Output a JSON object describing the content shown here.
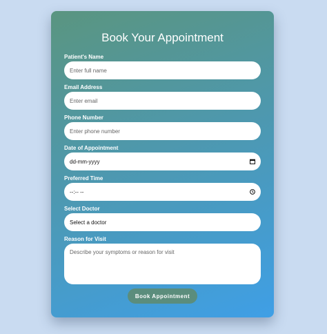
{
  "form": {
    "title": "Book Your Appointment",
    "patient_name": {
      "label": "Patient's Name",
      "placeholder": "Enter full name"
    },
    "email": {
      "label": "Email Address",
      "placeholder": "Enter email"
    },
    "phone": {
      "label": "Phone Number",
      "placeholder": "Enter phone number"
    },
    "date": {
      "label": "Date of Appointment",
      "value": "dd-mm-yyyy",
      "icon": "calendar-icon"
    },
    "time": {
      "label": "Preferred Time",
      "value": "--:-- --",
      "icon": "clock-icon"
    },
    "doctor": {
      "label": "Select Doctor",
      "value": "Select a doctor"
    },
    "reason": {
      "label": "Reason for Visit",
      "placeholder": "Describe your symptoms or reason for visit"
    },
    "submit_label": "Book Appointment"
  },
  "colors": {
    "page_background": "#c9dbf1",
    "card_gradient_start": "#5a9580",
    "card_gradient_end": "#3f9fe6",
    "button": "#5b8d7c"
  }
}
